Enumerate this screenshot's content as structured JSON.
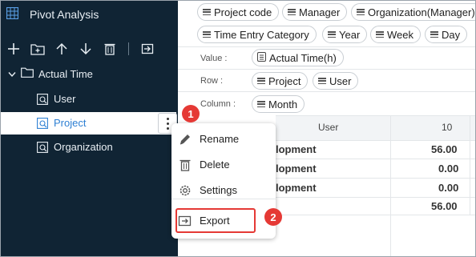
{
  "sidebar": {
    "title": "Pivot Analysis",
    "title_icon": "table-icon",
    "toolbar": [
      "add-icon",
      "new-folder-icon",
      "arrow-up-icon",
      "arrow-down-icon",
      "trash-icon",
      "import-icon"
    ],
    "tree": {
      "root_label": "Actual Time",
      "items": [
        {
          "label": "User"
        },
        {
          "label": "Project"
        },
        {
          "label": "Organization"
        }
      ]
    }
  },
  "fields": {
    "chips": [
      "Project code",
      "Manager",
      "Organization(Manager)",
      "Time Entry Category",
      "Year",
      "Week",
      "Day"
    ],
    "value_label": "Value :",
    "value_chips": [
      "Actual Time(h)"
    ],
    "row_label": "Row :",
    "row_chips": [
      "Project",
      "User"
    ],
    "column_label": "Column :",
    "column_chips": [
      "Month"
    ]
  },
  "grid": {
    "header_user": "User",
    "header_col": "10",
    "rows": [
      {
        "label": "lopment",
        "value": "56.00"
      },
      {
        "label": "lopment",
        "value": "0.00"
      },
      {
        "label": "lopment",
        "value": "0.00"
      },
      {
        "label": "",
        "value": "56.00"
      }
    ]
  },
  "context_menu": {
    "items": [
      {
        "label": "Rename",
        "icon": "pencil-icon"
      },
      {
        "label": "Delete",
        "icon": "trash-icon"
      },
      {
        "label": "Settings",
        "icon": "gear-icon"
      },
      {
        "label": "Export",
        "icon": "export-icon"
      }
    ]
  },
  "annotations": {
    "step1": "1",
    "step2": "2"
  },
  "colors": {
    "sidebar_bg": "#102434",
    "selected_text": "#2d7fd3",
    "annotation_red": "#e53935"
  }
}
